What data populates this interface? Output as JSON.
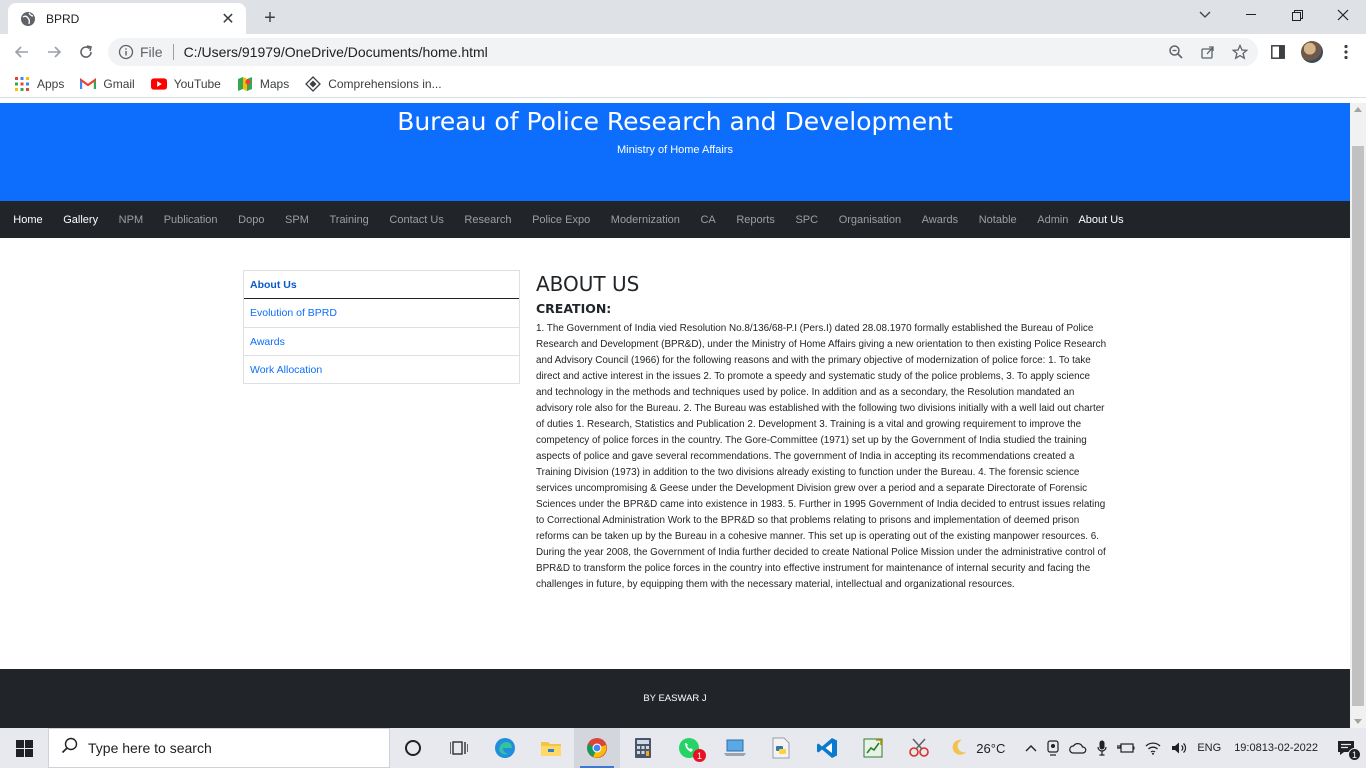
{
  "browser": {
    "tab_title": "BPRD",
    "tab_close": "✕",
    "new_tab": "+",
    "scheme_label": "File",
    "url": "C:/Users/91979/OneDrive/Documents/home.html",
    "bookmarks": [
      {
        "label": "Apps",
        "icon": "apps-grid-icon"
      },
      {
        "label": "Gmail",
        "icon": "gmail-icon"
      },
      {
        "label": "YouTube",
        "icon": "youtube-icon"
      },
      {
        "label": "Maps",
        "icon": "maps-icon"
      },
      {
        "label": "Comprehensions in...",
        "icon": "bookmark-diamond-icon"
      }
    ]
  },
  "site": {
    "title": "Bureau of Police Research and Development",
    "subtitle": "Ministry of Home Affairs",
    "header_color": "#0d6efd",
    "nav": [
      {
        "label": "Home",
        "active": true
      },
      {
        "label": "Gallery",
        "active": true
      },
      {
        "label": "NPM",
        "active": false
      },
      {
        "label": "Publication",
        "active": false
      },
      {
        "label": "Dopo",
        "active": false
      },
      {
        "label": "SPM",
        "active": false
      },
      {
        "label": "Training",
        "active": false
      },
      {
        "label": "Contact Us",
        "active": false
      },
      {
        "label": "Research",
        "active": false
      },
      {
        "label": "Police Expo",
        "active": false
      },
      {
        "label": "Modernization",
        "active": false
      },
      {
        "label": "CA",
        "active": false
      },
      {
        "label": "Reports",
        "active": false
      },
      {
        "label": "SPC",
        "active": false
      },
      {
        "label": "Organisation",
        "active": false
      },
      {
        "label": "Awards",
        "active": false
      },
      {
        "label": "Notable",
        "active": false
      },
      {
        "label": "Admin",
        "active": false
      },
      {
        "label": "About Us",
        "active": true
      }
    ],
    "sidebar": [
      {
        "label": "About Us"
      },
      {
        "label": "Evolution of BPRD"
      },
      {
        "label": "Awards"
      },
      {
        "label": "Work Allocation"
      }
    ],
    "content": {
      "heading": "ABOUT US",
      "subheading": "CREATION:",
      "body": "1. The Government of India vied Resolution No.8/136/68-P.I (Pers.I) dated 28.08.1970 formally established the Bureau of Police Research and Development (BPR&D), under the Ministry of Home Affairs giving a new orientation to then existing Police Research and Advisory Council (1966) for the following reasons and with the primary objective of modernization of police force: 1. To take direct and active interest in the issues 2. To promote a speedy and systematic study of the police problems, 3. To apply science and technology in the methods and techniques used by police. In addition and as a secondary, the Resolution mandated an advisory role also for the Bureau. 2. The Bureau was established with the following two divisions initially with a well laid out charter of duties 1. Research, Statistics and Publication 2. Development 3. Training is a vital and growing requirement to improve the competency of police forces in the country. The Gore-Committee (1971) set up by the Government of India studied the training aspects of police and gave several recommendations. The government of India in accepting its recommendations created a Training Division (1973) in addition to the two divisions already existing to function under the Bureau. 4. The forensic science services uncompromising & Geese under the Development Division grew over a period and a separate Directorate of Forensic Sciences under the BPR&D came into existence in 1983. 5. Further in 1995 Government of India decided to entrust issues relating to Correctional Administration Work to the BPR&D so that problems relating to prisons and implementation of deemed prison reforms can be taken up by the Bureau in a cohesive manner. This set up is operating out of the existing manpower resources. 6. During the year 2008, the Government of India further decided to create National Police Mission under the administrative control of BPR&D to transform the police forces in the country into effective instrument for maintenance of internal security and facing the challenges in future, by equipping them with the necessary material, intellectual and organizational resources."
    },
    "footer": "BY EASWAR J"
  },
  "taskbar": {
    "search_placeholder": "Type here to search",
    "weather": "26°C",
    "language": "ENG",
    "time": "19:08",
    "date": "13-02-2022",
    "whatsapp_badge": "1",
    "notification_badge": "1"
  }
}
